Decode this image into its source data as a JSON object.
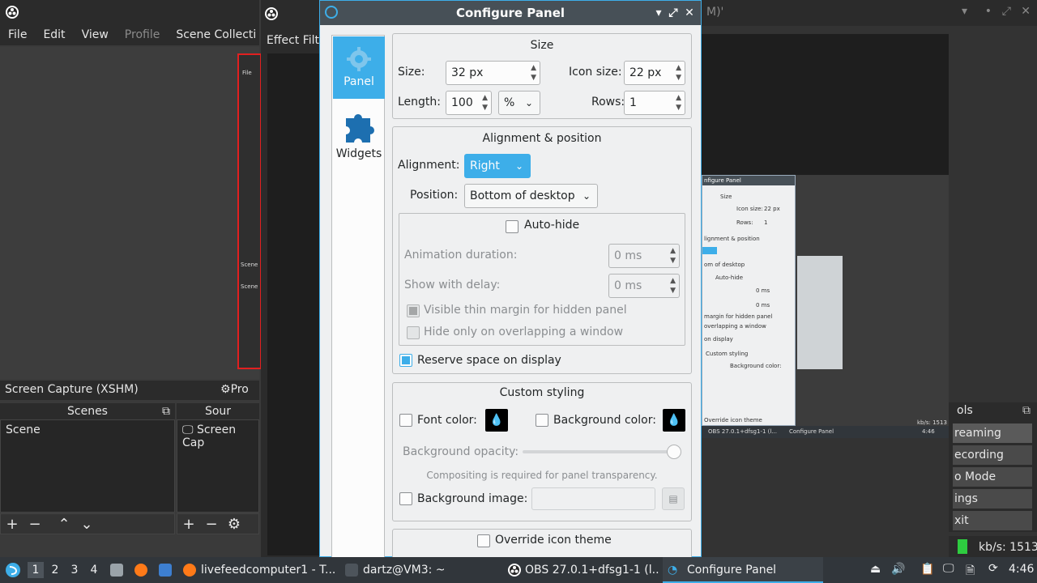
{
  "obs": {
    "menu": [
      "File",
      "Edit",
      "View",
      "Profile",
      "Scene Collecti"
    ],
    "effect_filters": "Effect Filt",
    "source_bar_label": "Screen Capture (XSHM)",
    "properties_label": "Pro",
    "scenes_title": "Scenes",
    "sources_title": "Sour",
    "scene_item": "Scene",
    "source_item": "Screen Cap",
    "mini_file": "File",
    "mini_scene1": "Scene",
    "mini_scene2": "Scene",
    "ctrl_buttons": [
      "reaming",
      "ecording",
      "o Mode",
      "ings",
      "xit"
    ],
    "ctrl_title": "ols",
    "kbs": "kb/s: 1513",
    "title_fragment": "M)'"
  },
  "dialog": {
    "title": "Configure Panel",
    "sidebar": {
      "panel": "Panel",
      "widgets": "Widgets"
    },
    "size": {
      "title": "Size",
      "size_label": "Size:",
      "size_value": "32 px",
      "icon_size_label": "Icon size:",
      "icon_size_value": "22 px",
      "length_label": "Length:",
      "length_value": "100",
      "length_unit": "%",
      "rows_label": "Rows:",
      "rows_value": "1"
    },
    "alignment": {
      "title": "Alignment & position",
      "alignment_label": "Alignment:",
      "alignment_value": "Right",
      "position_label": "Position:",
      "position_value": "Bottom of desktop",
      "autohide_label": "Auto-hide",
      "anim_label": "Animation duration:",
      "anim_value": "0 ms",
      "delay_label": "Show with delay:",
      "delay_value": "0 ms",
      "thin_margin_label": "Visible thin margin for hidden panel",
      "overlap_label": "Hide only on overlapping a window",
      "reserve_label": "Reserve space on display"
    },
    "styling": {
      "title": "Custom styling",
      "font_color_label": "Font color:",
      "bg_color_label": "Background color:",
      "bg_opacity_label": "Background opacity:",
      "opacity_level": 1.0,
      "compositing_note": "Compositing is required for panel transparency.",
      "bg_image_label": "Background image:",
      "override_label": "Override icon theme"
    }
  },
  "nested": {
    "title": "nfigure Panel",
    "size": "Size",
    "icon_size": "Icon size:",
    "icon_size_val": "22 px",
    "rows": "Rows:",
    "rows_val": "1",
    "align": "lignment & position",
    "pos": "om of desktop",
    "autohide": "Auto-hide",
    "ms1": "0 ms",
    "ms2": "0 ms",
    "margin": "margin for hidden panel",
    "overlap": "overlapping a window",
    "display": "on display",
    "custom": "Custom styling",
    "bgcolor": "Background color:",
    "override": "Override icon theme",
    "tb_obs": "OBS 27.0.1+dfsg1-1 (l...",
    "tb_cp": "Configure Panel",
    "kbs": "kb/s: 1513",
    "time": "4:46"
  },
  "taskbar": {
    "desktops": [
      "1",
      "2",
      "3",
      "4"
    ],
    "tasks": [
      {
        "label": "livefeedcomputer1 - T..."
      },
      {
        "label": "dartz@VM3: ~"
      },
      {
        "label": "OBS 27.0.1+dfsg1-1 (l..."
      },
      {
        "label": "Configure Panel"
      }
    ],
    "clock": "4:46"
  },
  "colors": {
    "accent": "#3daee9",
    "record_red": "#e12020",
    "status_green": "#2ecc40"
  }
}
